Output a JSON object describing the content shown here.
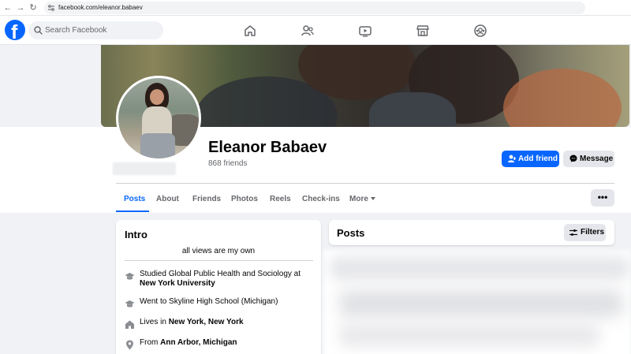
{
  "browser": {
    "url": "facebook.com/eleanor.babaev",
    "back_glyph": "←",
    "forward_glyph": "→",
    "reload_glyph": "↻"
  },
  "header": {
    "logo_letter": "f",
    "search_placeholder": "Search Facebook",
    "nav_icons": [
      "home-icon",
      "friends-icon",
      "watch-icon",
      "marketplace-icon",
      "groups-icon"
    ],
    "brand_color": "#0866ff"
  },
  "profile": {
    "name": "Eleanor Babaev",
    "friends": "868 friends",
    "add_friend_label": "Add friend",
    "message_label": "Message",
    "more_options_label": "•••"
  },
  "tabs": [
    {
      "label": "Posts",
      "active": true
    },
    {
      "label": "About"
    },
    {
      "label": "Friends"
    },
    {
      "label": "Photos"
    },
    {
      "label": "Reels"
    },
    {
      "label": "Check-ins"
    },
    {
      "label": "More"
    }
  ],
  "intro": {
    "title": "Intro",
    "bio": "all views are my own",
    "items": [
      {
        "icon": "graduation-cap-icon",
        "prefix": "Studied Global Public Health and Sociology at ",
        "bold": "New York University"
      },
      {
        "icon": "graduation-cap-icon",
        "prefix": "Went to Skyline High School (Michigan)",
        "bold": ""
      },
      {
        "icon": "home-icon",
        "prefix": "Lives in ",
        "bold": "New York, New York"
      },
      {
        "icon": "location-pin-icon",
        "prefix": "From ",
        "bold": "Ann Arbor, Michigan"
      }
    ]
  },
  "posts": {
    "title": "Posts",
    "filters_label": "Filters"
  }
}
